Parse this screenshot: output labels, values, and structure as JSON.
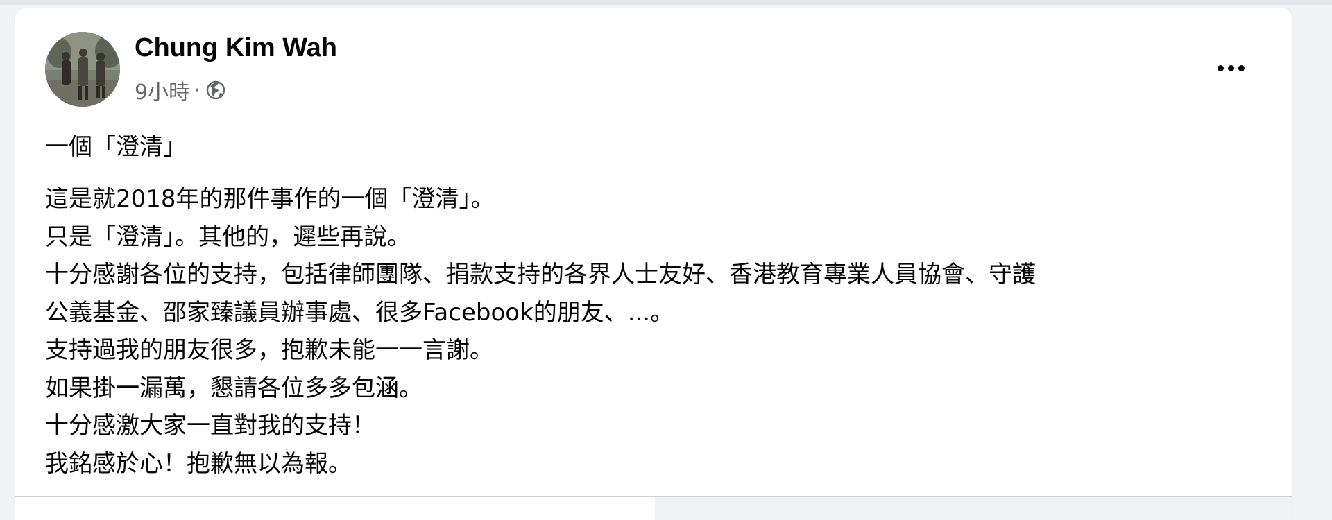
{
  "post": {
    "author": "Chung Kim Wah",
    "time": "9小時",
    "separator": "·",
    "title": "一個「澄清」",
    "lines": [
      "這是就2018年的那件事作的一個「澄清」。",
      "只是「澄清」。其他的，遲些再說。",
      "十分感謝各位的支持，包括律師團隊、捐款支持的各界人士友好、香港教育專業人員協會、守護",
      "公義基金、邵家臻議員辦事處、很多Facebook的朋友、...。",
      "支持過我的朋友很多，抱歉未能一一言謝。",
      "如果掛一漏萬，懇請各位多多包涵。",
      "十分感激大家一直對我的支持！",
      "我銘感於心！抱歉無以為報。"
    ]
  },
  "icons": {
    "privacy": "globe-icon",
    "more": "more-options-icon"
  },
  "colors": {
    "background": "#f0f2f5",
    "card": "#ffffff",
    "text": "#050505",
    "secondary_text": "#65676b"
  }
}
